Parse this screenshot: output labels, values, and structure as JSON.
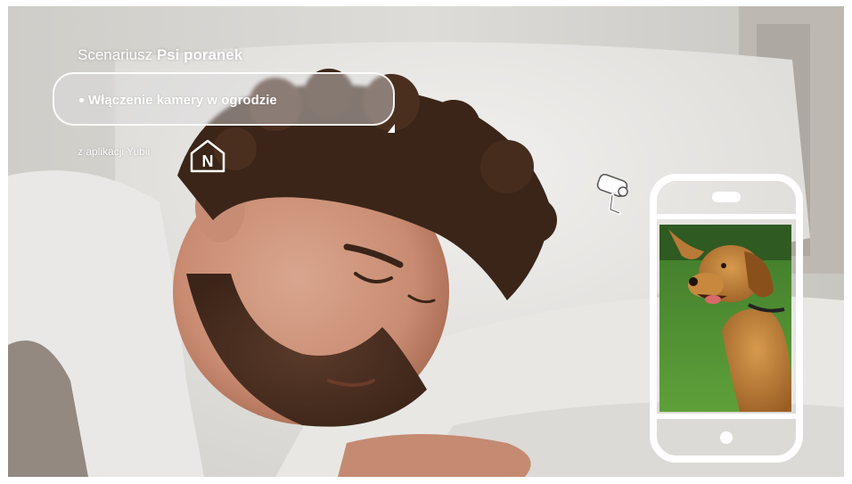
{
  "scenario": {
    "prefix": "Scenariusz",
    "name": "Psi poranek"
  },
  "action": {
    "label": "Włączenie kamery w ogrodzie"
  },
  "source": {
    "text": "z aplikacji Yubii",
    "logo_letter": "N"
  },
  "icons": {
    "camera": "security-camera-icon",
    "phone": "smartphone-icon",
    "app_logo": "house-n-icon"
  },
  "colors": {
    "overlay_text": "#ffffff",
    "phone_frame": "#ffffff"
  }
}
